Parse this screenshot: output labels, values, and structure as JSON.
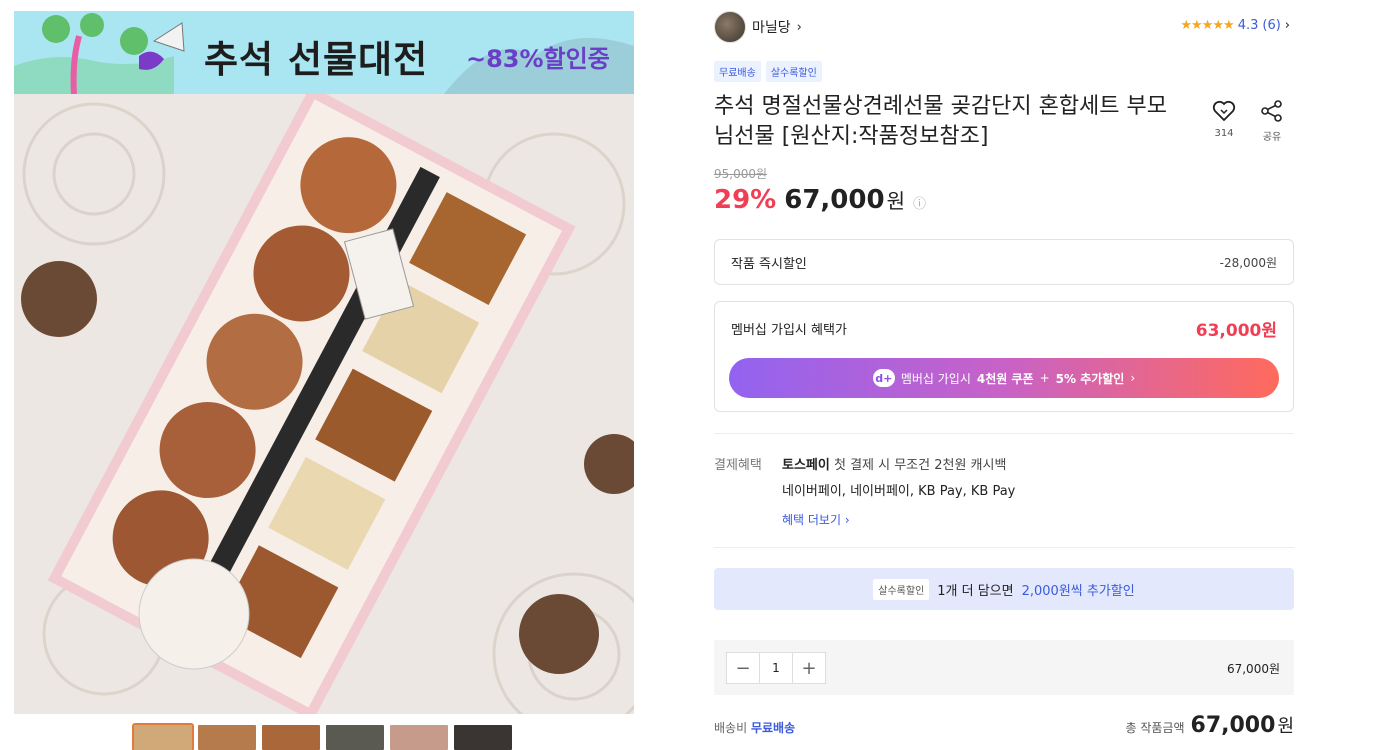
{
  "banner": {
    "title": "추석 선물대전",
    "sale": "~83%할인중"
  },
  "seller": {
    "name": "마닐당"
  },
  "rating": {
    "stars": "★★★★★",
    "score": "4.3",
    "count": "(6)"
  },
  "tags": [
    "무료배송",
    "살수록할인"
  ],
  "product": {
    "title": "추석 명절선물상견례선물 곶감단지 혼합세트 부모님선물 [원산지:작품정보참조]",
    "wish_count": "314",
    "share_label": "공유",
    "original_price": "95,000원",
    "discount": "29%",
    "price": "67,000",
    "price_unit": "원"
  },
  "instant_discount": {
    "label": "작품 즉시할인",
    "amount": "-28,000원"
  },
  "membership": {
    "label": "멤버십 가입시 혜택가",
    "price": "63,000원",
    "button_prefix": "멤버십 가입시",
    "button_coupon": "4천원 쿠폰",
    "button_plus": "+",
    "button_extra": "5% 추가할인",
    "plus_icon": "d+"
  },
  "payment": {
    "label": "결제혜택",
    "toss": "토스페이",
    "line1": "첫 결제 시 무조건 2천원 캐시백",
    "line2": "네이버페이, 네이버페이, KB Pay, KB Pay",
    "more": "혜택 더보기"
  },
  "bulk": {
    "badge": "살수록할인",
    "text": "1개 더 담으면",
    "highlight": "2,000원씩 추가할인"
  },
  "quantity": {
    "value": "1",
    "price": "67,000원"
  },
  "shipping": {
    "label": "배송비",
    "value": "무료배송"
  },
  "total": {
    "label": "총 작품금액",
    "price": "67,000",
    "unit": "원"
  },
  "icons": {
    "heart": "heart-icon",
    "share": "share-icon",
    "info": "info-icon",
    "chevron": "chevron-right-icon",
    "minus": "minus-icon",
    "plus": "plus-icon"
  },
  "colors": {
    "accent_red": "#f03e54",
    "accent_blue": "#3b5bdb",
    "star": "#f5a623",
    "banner_bg": "#a9e6f2",
    "member_grad_start": "#9263f0",
    "member_grad_end": "#ff6a5c"
  }
}
